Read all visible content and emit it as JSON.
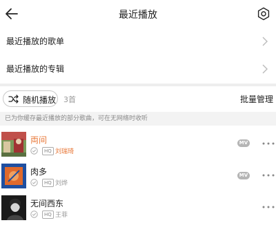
{
  "header": {
    "title": "最近播放"
  },
  "nav": {
    "playlists_label": "最近播放的歌单",
    "albums_label": "最近播放的专辑"
  },
  "controls": {
    "shuffle_label": "随机播放",
    "count": "3首",
    "batch_label": "批量管理"
  },
  "notice": "已为你缓存最近播放的部分歌曲，可在无网络时收听",
  "songs": [
    {
      "title": "両间",
      "quality": "HQ",
      "artist": "刘瑞琦",
      "has_mv": true,
      "title_color": "#e8793a",
      "artist_color": "#e8793a"
    },
    {
      "title": "肉多",
      "quality": "HQ",
      "artist": "刘烨",
      "has_mv": true,
      "title_color": "#222222",
      "artist_color": "#999999"
    },
    {
      "title": "无间西东",
      "quality": "HQ",
      "artist": "王菲",
      "has_mv": false,
      "title_color": "#222222",
      "artist_color": "#999999"
    }
  ],
  "mv_label": "MV",
  "icons": [
    "back-arrow-icon",
    "gear-icon",
    "chevron-right-icon",
    "shuffle-icon",
    "download-check-icon",
    "more-icon"
  ],
  "colors": {
    "accent": "#e8793a",
    "notice_bg": "#f3f3f3"
  }
}
